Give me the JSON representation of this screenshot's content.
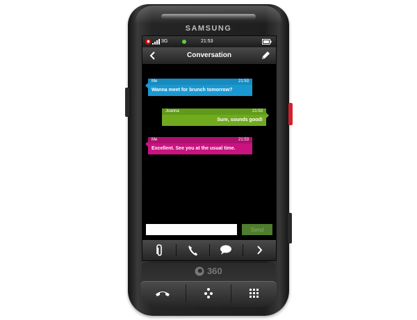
{
  "device": {
    "brand": "SAMSUNG",
    "logo_text": "360",
    "colors": {
      "body": "#232323",
      "red_key": "#d4212b"
    }
  },
  "statusbar": {
    "network": "3G",
    "time": "21:53",
    "icons": [
      "operator-logo-icon",
      "signal-bars-icon",
      "online-dot-icon",
      "battery-icon"
    ]
  },
  "titlebar": {
    "title": "Conversation",
    "back_icon": "chevron-left-icon",
    "edit_icon": "pencil-icon"
  },
  "messages": [
    {
      "sender": "Me",
      "time": "21:53",
      "text": "Wanna meet for brunch tomorrow?",
      "color": "#1a98d2",
      "side": "left"
    },
    {
      "sender": "Joanna",
      "time": "21:53",
      "text": "Sure, sounds good!",
      "color": "#6faa1f",
      "side": "right"
    },
    {
      "sender": "Me",
      "time": "21:53",
      "text": "Excellent. See you at the usual time.",
      "color": "#c9137f",
      "side": "left"
    }
  ],
  "compose": {
    "value": "",
    "placeholder": "",
    "send_label": "Send"
  },
  "toolbar": {
    "items": [
      "paperclip-icon",
      "phone-icon",
      "speech-bubble-icon",
      "chevron-right-icon"
    ]
  },
  "hardware_keys": [
    "call-icon",
    "menu-dots-icon",
    "grid-icon"
  ]
}
